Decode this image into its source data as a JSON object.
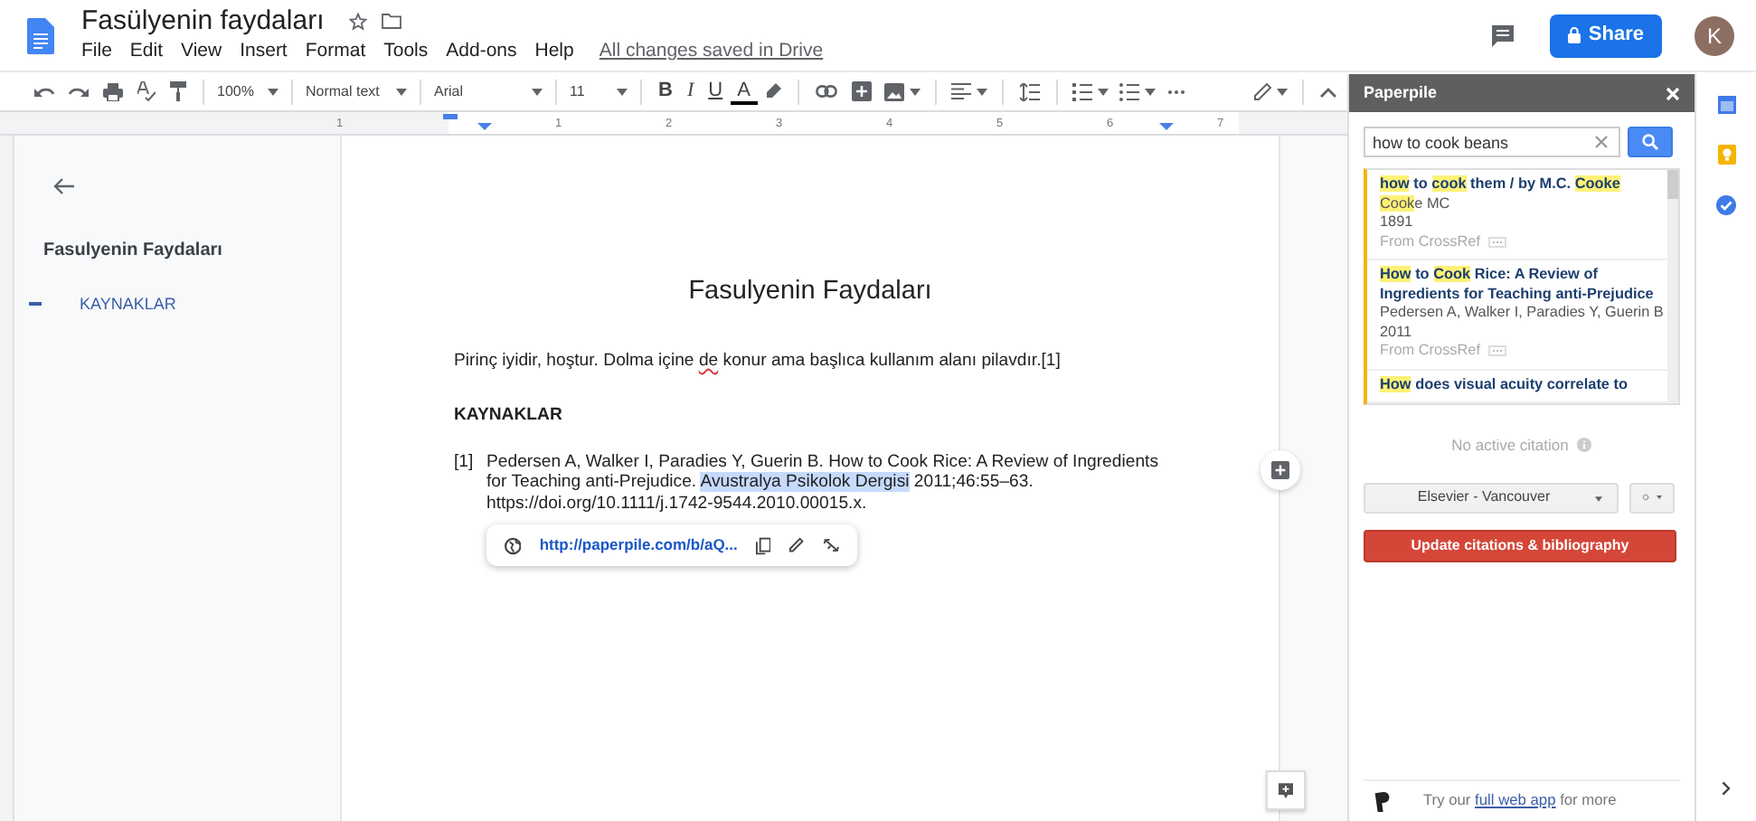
{
  "header": {
    "title": "Fasülyenin faydaları",
    "menus": [
      "File",
      "Edit",
      "View",
      "Insert",
      "Format",
      "Tools",
      "Add-ons",
      "Help"
    ],
    "save_status": "All changes saved in Drive",
    "share_button": "Share",
    "avatar": "K"
  },
  "toolbar": {
    "zoom": "100%",
    "style": "Normal text",
    "font": "Arial",
    "size": "11",
    "format_buttons": [
      {
        "label": "B",
        "kind": "bold"
      },
      {
        "label": "I",
        "kind": "italic"
      },
      {
        "label": "U",
        "kind": "underline"
      },
      {
        "label": "A",
        "kind": "color"
      }
    ]
  },
  "ruler": {
    "marks": [
      "1",
      "1",
      "2",
      "3",
      "4",
      "5",
      "6",
      "7"
    ]
  },
  "outline": {
    "title": "Fasulyenin Faydaları",
    "items": [
      {
        "label": "KAYNAKLAR",
        "selected": true
      }
    ]
  },
  "page": {
    "title": "Fasulyenin Faydaları",
    "paragraph": [
      {
        "text": "Pirinç iyidir, hoştur. Dolma içine ",
        "misspelled": false
      },
      {
        "text": "de",
        "misspelled": true
      },
      {
        "text": " konur ama başlıca kullanım alanı pilavdır.[1]",
        "misspelled": false
      }
    ],
    "heading": "KAYNAKLAR",
    "references": [
      {
        "number": "[1]",
        "segments": [
          {
            "text": "Pedersen A, Walker I, Paradies Y, Guerin B. How to Cook Rice: A Review of Ingredients for Teaching anti-Prejudice. ",
            "selected": false
          },
          {
            "text": "Avustralya Psikolok Dergisi",
            "selected": true
          },
          {
            "text": " 2011;46:55–63. https://doi.org/10.1111/j.1742-9544.2010.00015.x.",
            "selected": false
          }
        ]
      }
    ],
    "link_popup": {
      "url": "http://paperpile.com/b/aQ..."
    }
  },
  "paperpile": {
    "title": "Paperpile",
    "search": {
      "value": "how to cook beans"
    },
    "results": [
      {
        "title": [
          {
            "text": "how",
            "highlight": true
          },
          {
            "text": " to ",
            "highlight": false
          },
          {
            "text": "cook",
            "highlight": true
          },
          {
            "text": " them / by M.C. ",
            "highlight": false
          },
          {
            "text": "Cooke",
            "highlight": true
          }
        ],
        "authors": [
          {
            "text": "Cook",
            "highlight": true
          },
          {
            "text": "e MC",
            "highlight": false
          }
        ],
        "year": "1891",
        "source": "From CrossRef"
      },
      {
        "title": [
          {
            "text": "How",
            "highlight": true
          },
          {
            "text": " to ",
            "highlight": false
          },
          {
            "text": "Cook",
            "highlight": true
          },
          {
            "text": " Rice: A Review of Ingredients for Teaching anti-Prejudice",
            "highlight": false
          }
        ],
        "authors": [
          {
            "text": "Pedersen A, Walker I, Paradies Y, Guerin B",
            "highlight": false
          }
        ],
        "year": "2011",
        "source": "From CrossRef"
      },
      {
        "title": [
          {
            "text": "How",
            "highlight": true
          },
          {
            "text": " does visual acuity correlate to",
            "highlight": false
          }
        ]
      }
    ],
    "status": "No active citation",
    "style_select": "Elsevier - Vancouver",
    "update_button": "Update citations & bibliography",
    "footer": {
      "before": "Try our ",
      "link": "full web app",
      "after": " for more"
    }
  }
}
